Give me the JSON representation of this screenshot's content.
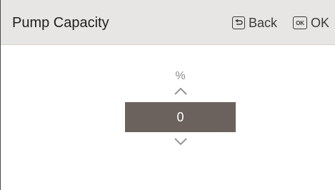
{
  "header": {
    "title": "Pump Capacity",
    "back_label": "Back",
    "back_icon": "back-arrow-icon",
    "ok_label": "OK",
    "ok_icon_text": "OK"
  },
  "setting": {
    "unit": "%",
    "value": "0",
    "increase_icon": "chevron-up-icon",
    "decrease_icon": "chevron-down-icon"
  }
}
